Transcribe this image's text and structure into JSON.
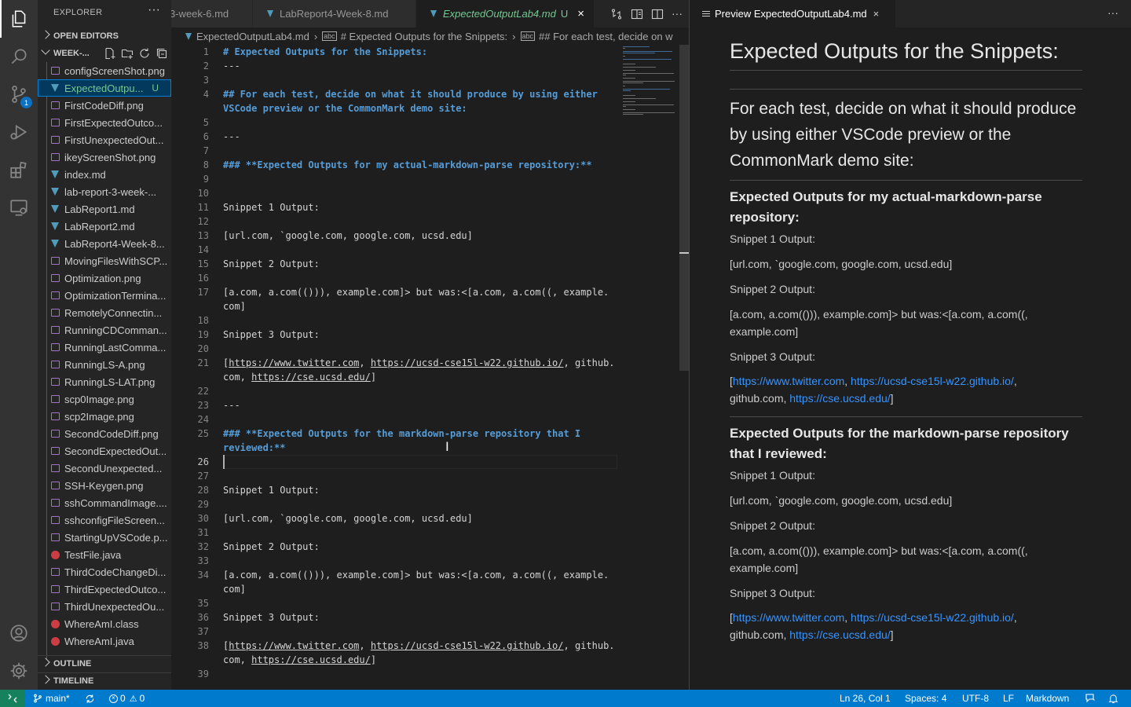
{
  "explorer": {
    "title": "EXPLORER",
    "open_editors": "OPEN EDITORS",
    "folder": "WEEK-...",
    "outline": "OUTLINE",
    "timeline": "TIMELINE",
    "files": [
      {
        "name": "configScreenShot.png",
        "type": "img"
      },
      {
        "name": "ExpectedOutpu...",
        "type": "md",
        "status": "U",
        "selected": true
      },
      {
        "name": "FirstCodeDiff.png",
        "type": "img"
      },
      {
        "name": "FirstExpectedOutco...",
        "type": "img"
      },
      {
        "name": "FirstUnexpectedOut...",
        "type": "img"
      },
      {
        "name": "ikeyScreenShot.png",
        "type": "img"
      },
      {
        "name": "index.md",
        "type": "md"
      },
      {
        "name": "lab-report-3-week-...",
        "type": "md"
      },
      {
        "name": "LabReport1.md",
        "type": "md"
      },
      {
        "name": "LabReport2.md",
        "type": "md"
      },
      {
        "name": "LabReport4-Week-8...",
        "type": "md"
      },
      {
        "name": "MovingFilesWithSCP...",
        "type": "img"
      },
      {
        "name": "Optimization.png",
        "type": "img"
      },
      {
        "name": "OptimizationTermina...",
        "type": "img"
      },
      {
        "name": "RemotelyConnectin...",
        "type": "img"
      },
      {
        "name": "RunningCDComman...",
        "type": "img"
      },
      {
        "name": "RunningLastComma...",
        "type": "img"
      },
      {
        "name": "RunningLS-A.png",
        "type": "img"
      },
      {
        "name": "RunningLS-LAT.png",
        "type": "img"
      },
      {
        "name": "scp0Image.png",
        "type": "img"
      },
      {
        "name": "scp2Image.png",
        "type": "img"
      },
      {
        "name": "SecondCodeDiff.png",
        "type": "img"
      },
      {
        "name": "SecondExpectedOut...",
        "type": "img"
      },
      {
        "name": "SecondUnexpected...",
        "type": "img"
      },
      {
        "name": "SSH-Keygen.png",
        "type": "img"
      },
      {
        "name": "sshCommandImage....",
        "type": "img"
      },
      {
        "name": "sshconfigFileScreen...",
        "type": "img"
      },
      {
        "name": "StartingUpVSCode.p...",
        "type": "img"
      },
      {
        "name": "TestFile.java",
        "type": "java"
      },
      {
        "name": "ThirdCodeChangeDi...",
        "type": "img"
      },
      {
        "name": "ThirdExpectedOutco...",
        "type": "img"
      },
      {
        "name": "ThirdUnexpectedOu...",
        "type": "img"
      },
      {
        "name": "WhereAmI.class",
        "type": "java"
      },
      {
        "name": "WhereAmI.java",
        "type": "java"
      }
    ]
  },
  "activity": {
    "scm_badge": "1"
  },
  "tabs": [
    {
      "label": "3-week-6.md"
    },
    {
      "label": "LabReport4-Week-8.md"
    },
    {
      "label": "ExpectedOutputLab4.md",
      "status": "U",
      "active": true
    }
  ],
  "breadcrumb": {
    "file": "ExpectedOutputLab4.md",
    "h1": "# Expected Outputs for the Snippets:",
    "h2": "## For each test, decide on w"
  },
  "editor": {
    "lines": [
      {
        "n": "1",
        "text": "# Expected Outputs for the Snippets:",
        "kind": "h"
      },
      {
        "n": "2",
        "text": "---"
      },
      {
        "n": "3",
        "text": ""
      },
      {
        "n": "4",
        "text": "## For each test, decide on what it should produce by using either",
        "kind": "h"
      },
      {
        "n": "",
        "text": "VSCode preview or the CommonMark demo site:",
        "kind": "h"
      },
      {
        "n": "5",
        "text": ""
      },
      {
        "n": "6",
        "text": "---"
      },
      {
        "n": "7",
        "text": ""
      },
      {
        "n": "8",
        "text": "### **Expected Outputs for my actual-markdown-parse repository:**",
        "kind": "h"
      },
      {
        "n": "9",
        "text": ""
      },
      {
        "n": "10",
        "text": ""
      },
      {
        "n": "11",
        "text": "Snippet 1 Output:"
      },
      {
        "n": "12",
        "text": ""
      },
      {
        "n": "13",
        "text": "[url.com, `google.com, google.com, ucsd.edu]"
      },
      {
        "n": "14",
        "text": ""
      },
      {
        "n": "15",
        "text": "Snippet 2 Output:"
      },
      {
        "n": "16",
        "text": ""
      },
      {
        "n": "17",
        "text": "[a.com, a.com(())), example.com]> but was:<[a.com, a.com((, example."
      },
      {
        "n": "",
        "text": "com]"
      },
      {
        "n": "18",
        "text": ""
      },
      {
        "n": "19",
        "text": "Snippet 3 Output:"
      },
      {
        "n": "20",
        "text": ""
      },
      {
        "n": "21",
        "text": "[https://www.twitter.com, https://ucsd-cse15l-w22.github.io/, github.",
        "kind": "link"
      },
      {
        "n": "",
        "text": "com, https://cse.ucsd.edu/]",
        "kind": "link2"
      },
      {
        "n": "22",
        "text": ""
      },
      {
        "n": "23",
        "text": "---"
      },
      {
        "n": "24",
        "text": ""
      },
      {
        "n": "25",
        "text": "### **Expected Outputs for the markdown-parse repository that I",
        "kind": "h"
      },
      {
        "n": "",
        "text": "reviewed:**",
        "kind": "h"
      },
      {
        "n": "26",
        "text": "",
        "current": true
      },
      {
        "n": "27",
        "text": ""
      },
      {
        "n": "28",
        "text": "Snippet 1 Output:"
      },
      {
        "n": "29",
        "text": ""
      },
      {
        "n": "30",
        "text": "[url.com, `google.com, google.com, ucsd.edu]"
      },
      {
        "n": "31",
        "text": ""
      },
      {
        "n": "32",
        "text": "Snippet 2 Output:"
      },
      {
        "n": "33",
        "text": ""
      },
      {
        "n": "34",
        "text": "[a.com, a.com(())), example.com]> but was:<[a.com, a.com((, example."
      },
      {
        "n": "",
        "text": "com]"
      },
      {
        "n": "35",
        "text": ""
      },
      {
        "n": "36",
        "text": "Snippet 3 Output:"
      },
      {
        "n": "37",
        "text": ""
      },
      {
        "n": "38",
        "text": "[https://www.twitter.com, https://ucsd-cse15l-w22.github.io/, github.",
        "kind": "link"
      },
      {
        "n": "",
        "text": "com, https://cse.ucsd.edu/]",
        "kind": "link2"
      },
      {
        "n": "39",
        "text": ""
      }
    ]
  },
  "preview": {
    "tab_label": "Preview ExpectedOutputLab4.md",
    "h1": "Expected Outputs for the Snippets:",
    "h2": "For each test, decide on what it should produce by using either VSCode preview or the CommonMark demo site:",
    "h3a": "Expected Outputs for my actual-markdown-parse repository:",
    "h3b": "Expected Outputs for the markdown-parse repository that I reviewed:",
    "s1_label": "Snippet 1 Output:",
    "s1_value": "[url.com, `google.com, google.com, ucsd.edu]",
    "s2_label": "Snippet 2 Output:",
    "s2_value": "[a.com, a.com(())), example.com]> but was:<[a.com, a.com((, example.com]",
    "s3_label": "Snippet 3 Output:",
    "link1": "https://www.twitter.com",
    "link2": "https://ucsd-cse15l-w22.github.io/",
    "link3": "https://cse.ucsd.edu/",
    "s3_mid": "github.com"
  },
  "status": {
    "branch": "main*",
    "errors": "0",
    "warnings": "0",
    "position": "Ln 26, Col 1",
    "spaces": "Spaces: 4",
    "encoding": "UTF-8",
    "eol": "LF",
    "language": "Markdown"
  },
  "colors": {
    "accent": "#007acc",
    "heading": "#569cd6",
    "link": "#3794ff",
    "untracked": "#73c991"
  }
}
